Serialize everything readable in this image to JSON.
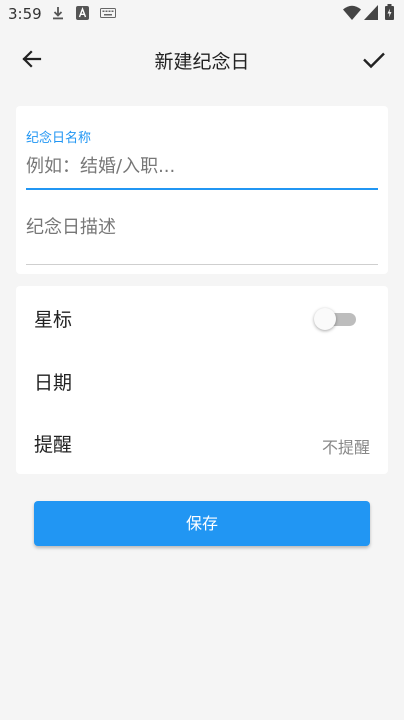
{
  "status_bar": {
    "time": "3:59",
    "icons": [
      "download-icon",
      "notification-a-icon",
      "keyboard-icon",
      "wifi-icon",
      "signal-icon",
      "battery-icon"
    ]
  },
  "header": {
    "title": "新建纪念日",
    "back_icon": "arrow-left-icon",
    "confirm_icon": "check-icon"
  },
  "form": {
    "title_label": "纪念日名称",
    "title_placeholder": "例如：结婚/入职...",
    "title_value": "",
    "description_placeholder": "纪念日描述",
    "description_value": ""
  },
  "options": {
    "star_label": "星标",
    "star_enabled": false,
    "date_label": "日期",
    "date_value": "",
    "reminder_label": "提醒",
    "reminder_value": "不提醒"
  },
  "actions": {
    "save_label": "保存"
  },
  "colors": {
    "accent": "#2196f3",
    "background": "#f5f5f5",
    "card": "#ffffff"
  }
}
